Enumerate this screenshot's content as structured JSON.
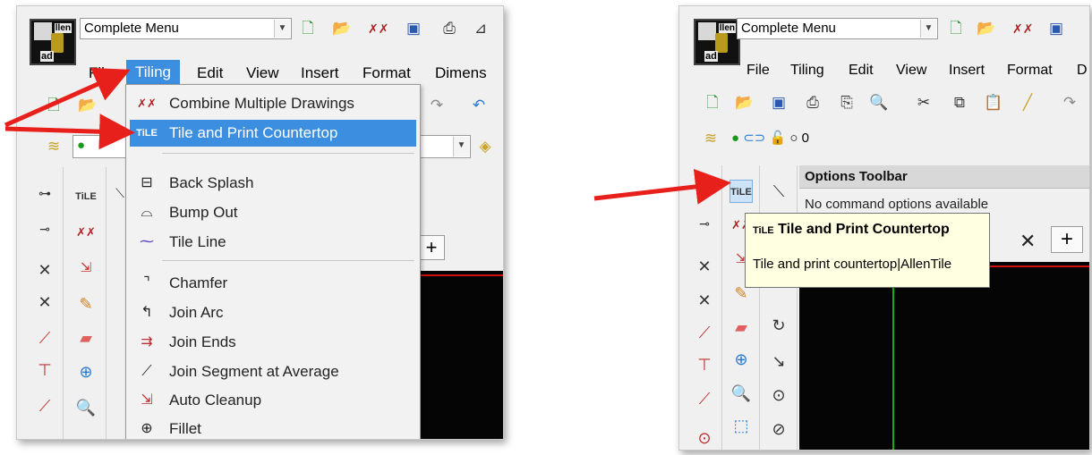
{
  "left": {
    "combo_value": "Complete Menu",
    "menubar": [
      "File",
      "Tiling",
      "Edit",
      "View",
      "Insert",
      "Format",
      "Dimens"
    ],
    "dropdown": [
      {
        "label": "Combine Multiple Drawings",
        "icon": "combine-icon"
      },
      {
        "label": "Tile and Print Countertop",
        "icon": "tile-icon"
      },
      {
        "label": "Back Splash",
        "icon": "backsplash-icon"
      },
      {
        "label": "Bump Out",
        "icon": "bumpout-icon"
      },
      {
        "label": "Tile Line",
        "icon": "tileline-icon"
      },
      {
        "label": "Chamfer",
        "icon": "chamfer-icon"
      },
      {
        "label": "Join Arc",
        "icon": "joinarc-icon"
      },
      {
        "label": "Join Ends",
        "icon": "joinends-icon"
      },
      {
        "label": "Join Segment at Average",
        "icon": "joinsegment-icon"
      },
      {
        "label": "Auto Cleanup",
        "icon": "autocleanup-icon"
      },
      {
        "label": "Fillet",
        "icon": "fillet-icon"
      }
    ],
    "tile_glyph": "TiLE"
  },
  "right": {
    "combo_value": "Complete Menu",
    "menubar": [
      "File",
      "Tiling",
      "Edit",
      "View",
      "Insert",
      "Format",
      "D"
    ],
    "layer_value": "0",
    "options_title": "Options Toolbar",
    "options_text": "No command options available",
    "tooltip_title": "Tile and Print Countertop",
    "tooltip_desc": "Tile and print countertop|AllenTile",
    "tile_glyph": "TiLE"
  },
  "colors": {
    "highlight": "#3c8fe0",
    "arrow": "#e8201c",
    "green_line": "#10b010",
    "red_line": "#d01010"
  }
}
